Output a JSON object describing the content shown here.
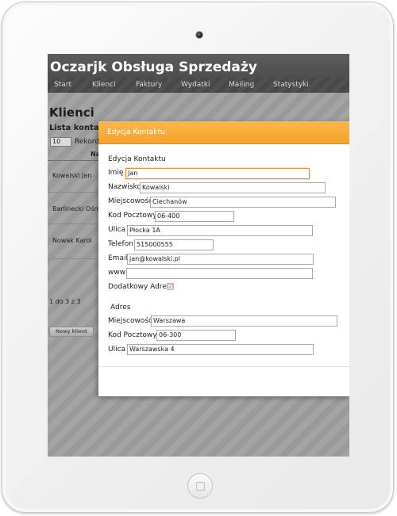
{
  "app": {
    "title": "Oczarjk Obsługa Sprzedaży",
    "nav": [
      "Start",
      "Klienci",
      "Faktury",
      "Wydatki",
      "Mailing",
      "Statystyki"
    ]
  },
  "page": {
    "title": "Klienci",
    "list_title": "Lista kontaktó",
    "records_value": "10",
    "records_label": "Rekord",
    "column_header": "Na",
    "rows": [
      "Kowalski Jan",
      "Barlinecki Ośrod",
      "Nowak Karol"
    ],
    "pagination": "1 do 3 z 3",
    "new_button": "Nowy klient"
  },
  "dialog": {
    "title": "Edycja Kontaktu",
    "section_title": "Edycja Kontaktu",
    "fields": {
      "imie": {
        "label": "Imię",
        "value": "Jan"
      },
      "nazwisko": {
        "label": "Nazwisko",
        "value": "Kowalski"
      },
      "miejscowosc": {
        "label": "Miejscowość",
        "value": "Ciechanów"
      },
      "kod": {
        "label": "Kod Pocztowy",
        "value": "06-400"
      },
      "ulica": {
        "label": "Ulica",
        "value": "Płocka 1A"
      },
      "telefon": {
        "label": "Telefon",
        "value": "515000555"
      },
      "email": {
        "label": "Email",
        "value": "jan@kowalski.pl"
      },
      "www": {
        "label": "www",
        "value": ""
      }
    },
    "extra_address": {
      "label": "Dodatkowy Adres",
      "checked": "☑"
    },
    "address_section": "Adres",
    "address_fields": {
      "miejscowosc": {
        "label": "Miejscowość",
        "value": "Warszawa"
      },
      "kod": {
        "label": "Kod Pocztowy",
        "value": "06-300"
      },
      "ulica": {
        "label": "Ulica",
        "value": "Warszawska 4"
      }
    }
  },
  "colors": {
    "accent": "#f7a22a",
    "header_bg": "#4f4f4f",
    "overlay_bg": "#9b9b9b"
  }
}
